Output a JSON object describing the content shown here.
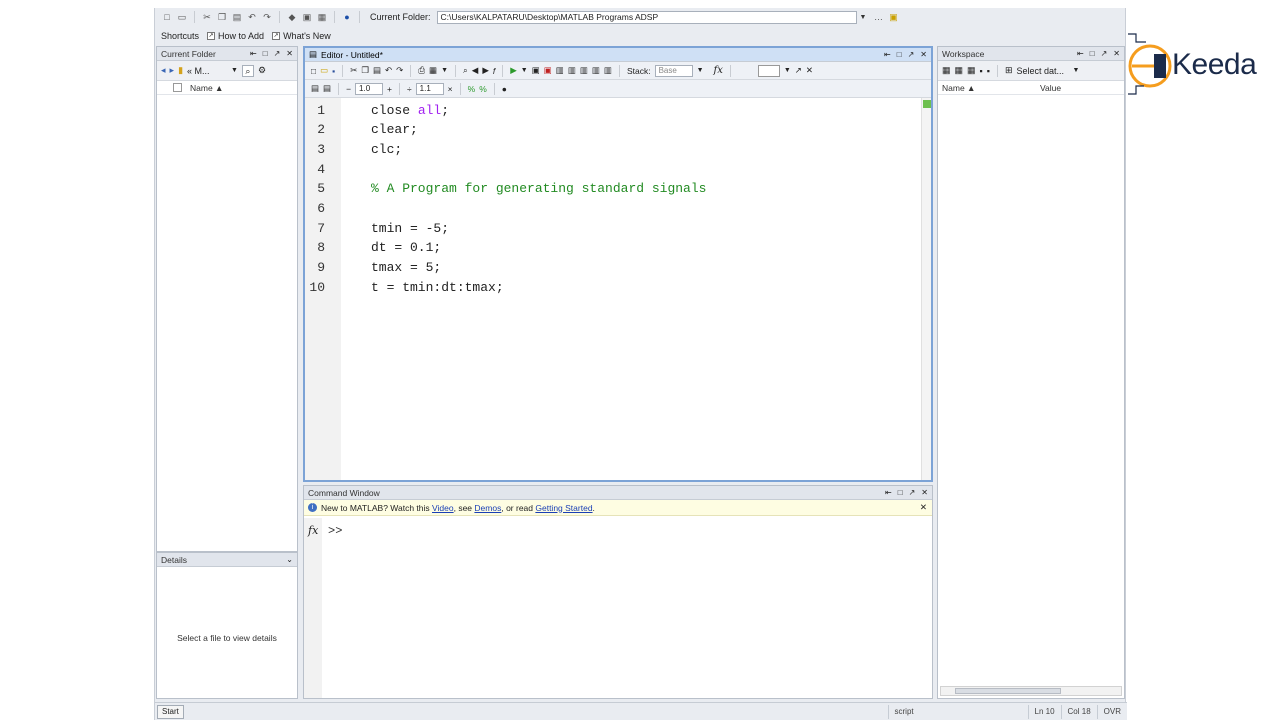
{
  "toolbar": {
    "current_folder_label": "Current Folder:",
    "current_folder_path": "C:\\Users\\KALPATARU\\Desktop\\MATLAB Programs ADSP"
  },
  "shortcuts": {
    "items": [
      "Shortcuts",
      "How to Add",
      "What's New"
    ]
  },
  "current_folder_panel": {
    "title": "Current Folder",
    "nav_text": "« M...",
    "column_name": "Name ▲"
  },
  "details_panel": {
    "title": "Details",
    "message": "Select a file to view details"
  },
  "editor": {
    "title": "Editor - Untitled*",
    "stack_label": "Stack:",
    "stack_value": "Base",
    "cell_value1": "1.0",
    "cell_value2": "1.1",
    "lines": [
      {
        "num": "1",
        "pre": "close ",
        "kw": "all",
        "post": ";",
        "comment": ""
      },
      {
        "num": "2",
        "pre": "clear;",
        "kw": "",
        "post": "",
        "comment": ""
      },
      {
        "num": "3",
        "pre": "clc;",
        "kw": "",
        "post": "",
        "comment": ""
      },
      {
        "num": "4",
        "pre": "",
        "kw": "",
        "post": "",
        "comment": ""
      },
      {
        "num": "5",
        "pre": "",
        "kw": "",
        "post": "",
        "comment": "% A Program for generating standard signals"
      },
      {
        "num": "6",
        "pre": "",
        "kw": "",
        "post": "",
        "comment": ""
      },
      {
        "num": "7",
        "pre": "tmin = -5;",
        "kw": "",
        "post": "",
        "comment": ""
      },
      {
        "num": "8",
        "pre": "dt = 0.1;",
        "kw": "",
        "post": "",
        "comment": ""
      },
      {
        "num": "9",
        "pre": "tmax = 5;",
        "kw": "",
        "post": "",
        "comment": ""
      },
      {
        "num": "10",
        "pre": "t = tmin:dt:tmax;",
        "kw": "",
        "post": "",
        "comment": ""
      }
    ]
  },
  "command_window": {
    "title": "Command Window",
    "notice_prefix": "New to MATLAB? Watch this ",
    "notice_video": "Video",
    "notice_mid1": ", see ",
    "notice_demos": "Demos",
    "notice_mid2": ", or read ",
    "notice_getting_started": "Getting Started",
    "notice_suffix": ".",
    "prompt": ">>"
  },
  "workspace_panel": {
    "title": "Workspace",
    "select_data": "Select dat...",
    "col_name": "Name ▲",
    "col_value": "Value"
  },
  "statusbar": {
    "start": "Start",
    "mode": "script",
    "ln": "Ln  10",
    "col": "Col  18",
    "ovr": "OVR"
  },
  "logo": {
    "text": "Keeda"
  },
  "colors": {
    "keyword": "#a020f0",
    "comment": "#228b22",
    "editor_border": "#7ca3d6",
    "logo_orange": "#f59d1e"
  }
}
